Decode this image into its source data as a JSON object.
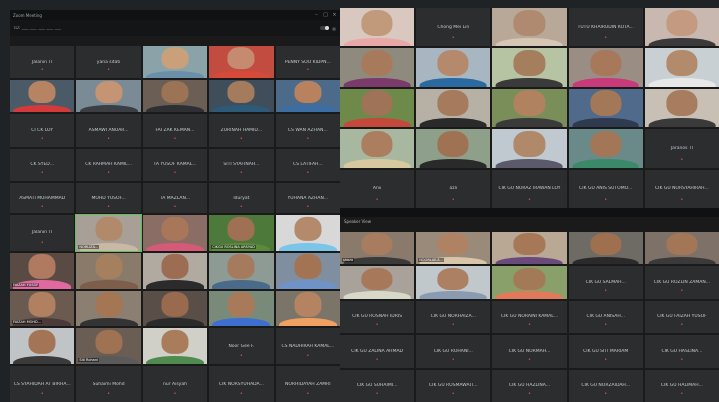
{
  "window_title": "Zoom Meeting",
  "menu_text": "ID: ___  ___  ___  ___  ___",
  "pin_text": "Speaker View",
  "tl": {
    "tiles": [
      {
        "name": "Jalanin TI",
        "kind": "name"
      },
      {
        "name": "yana sitati",
        "kind": "name"
      },
      {
        "name": "",
        "kind": "video",
        "skin": "#c9a07a",
        "shirt": "#6a8fa8",
        "bg": "#8aa3a8"
      },
      {
        "name": "",
        "kind": "video",
        "skin": "#c58a70",
        "shirt": "#d64a3a",
        "bg": "#c24c3f"
      },
      {
        "name": "PENNY SOO KIDPN...",
        "kind": "name"
      },
      {
        "name": "",
        "kind": "video",
        "skin": "#b78463",
        "shirt": "#d43a3a",
        "bg": "#4a5a66"
      },
      {
        "name": "",
        "kind": "video",
        "skin": "#c59472",
        "shirt": "#3b3f44",
        "bg": "#7b8b96"
      },
      {
        "name": "",
        "kind": "video",
        "skin": "#9d7355",
        "shirt": "#2d2f33",
        "bg": "#6b5e54"
      },
      {
        "name": "",
        "kind": "video",
        "skin": "#a57b5d",
        "shirt": "#2e5a7a",
        "bg": "#3f4e5a"
      },
      {
        "name": "",
        "kind": "video",
        "skin": "#b8825e",
        "shirt": "#3a6ea5",
        "bg": "#4c6b8a"
      },
      {
        "name": "CI CK LOY",
        "kind": "name"
      },
      {
        "name": "ASMAWI ANUAR...",
        "kind": "name"
      },
      {
        "name": "FAI ZAK KEMAN...",
        "kind": "name"
      },
      {
        "name": "ZURINAH HAMID...",
        "kind": "name"
      },
      {
        "name": "CS WAN AZHAN...",
        "kind": "name"
      },
      {
        "name": "CK SYED...",
        "kind": "name"
      },
      {
        "name": "CK RAHMAH KAMIL...",
        "kind": "name"
      },
      {
        "name": "TA YUSOF KAMAL...",
        "kind": "name"
      },
      {
        "name": "SITI SYAFINAH...",
        "kind": "name"
      },
      {
        "name": "CS LATIFAH...",
        "kind": "name"
      },
      {
        "name": "ASMATI MUHAMMAD",
        "kind": "name"
      },
      {
        "name": "MOHD YUSOF...",
        "kind": "name"
      },
      {
        "name": "TA MAZLAN...",
        "kind": "name"
      },
      {
        "name": "Iduryat",
        "kind": "name"
      },
      {
        "name": "YUHANA AZHAN...",
        "kind": "name"
      }
    ]
  },
  "bl": {
    "tiles": [
      {
        "name": "Jalanin TI",
        "kind": "name"
      },
      {
        "name": "NORLIZA...",
        "kind": "video",
        "skin": "#b08a6a",
        "shirt": "#c9b8a6",
        "bg": "#a8a096",
        "active": true
      },
      {
        "name": "",
        "kind": "video",
        "skin": "#a8775a",
        "shirt": "#d55a78",
        "bg": "#8a6d64"
      },
      {
        "name": "CIKGU ROSLINA ARSYAD",
        "kind": "video",
        "skin": "#a07055",
        "shirt": "#5b8a3d",
        "bg": "#4d7a3a"
      },
      {
        "name": "",
        "kind": "video",
        "skin": "#b48a6c",
        "shirt": "#7bc5e8",
        "bg": "#d8d8d8"
      },
      {
        "name": "FAIZAH YUSOF",
        "kind": "video",
        "skin": "#b07a60",
        "shirt": "#e06aa0",
        "bg": "#5a4a44"
      },
      {
        "name": "",
        "kind": "video",
        "skin": "#a5805e",
        "shirt": "#7d5e4a",
        "bg": "#8a7a6a"
      },
      {
        "name": "",
        "kind": "video",
        "skin": "#9c6d52",
        "shirt": "#2b2b2b",
        "bg": "#b0aaa0"
      },
      {
        "name": "",
        "kind": "video",
        "skin": "#a67b5d",
        "shirt": "#4a6a8a",
        "bg": "#8e9a94"
      },
      {
        "name": "",
        "kind": "video",
        "skin": "#a27454",
        "shirt": "#6f93c8",
        "bg": "#7f8fa0"
      },
      {
        "name": "FAIZAH MOHD...",
        "kind": "video",
        "skin": "#b08060",
        "shirt": "#4a3a3a",
        "bg": "#6b5a4f"
      },
      {
        "name": "",
        "kind": "video",
        "skin": "#a47654",
        "shirt": "#333333",
        "bg": "#8a7f70"
      },
      {
        "name": "",
        "kind": "video",
        "skin": "#9a6a4f",
        "shirt": "#2a2a2a",
        "bg": "#5a4f48"
      },
      {
        "name": "",
        "kind": "video",
        "skin": "#a87a5a",
        "shirt": "#3d6fd0",
        "bg": "#7a8a7a"
      },
      {
        "name": "",
        "kind": "video",
        "skin": "#b48462",
        "shirt": "#f0a060",
        "bg": "#7b7468"
      },
      {
        "name": "",
        "kind": "video",
        "skin": "#a37556",
        "shirt": "#3a3a3a",
        "bg": "#c0c4c6"
      },
      {
        "name": "Siti Rohani",
        "kind": "video",
        "skin": "#9e7252",
        "shirt": "#5a5a5a",
        "bg": "#6a5e54"
      },
      {
        "name": "",
        "kind": "video",
        "skin": "#a97c5c",
        "shirt": "#4f8a4f",
        "bg": "#d0d0c8"
      },
      {
        "name": "Noor Gee F.",
        "kind": "name"
      },
      {
        "name": "CS NADHIRAH KAMAL...",
        "kind": "name"
      },
      {
        "name": "CS SYAHIDAH AT BIRHA...",
        "kind": "name"
      },
      {
        "name": "Suhaimi Mohd",
        "kind": "name"
      },
      {
        "name": "nur Aisyah",
        "kind": "name"
      },
      {
        "name": "CIK NORSYUHADA...",
        "kind": "name"
      },
      {
        "name": "NORHIDAYAH ZAMRI",
        "kind": "name"
      }
    ]
  },
  "tr": {
    "tiles": [
      {
        "name": "",
        "kind": "video",
        "skin": "#c09a7a",
        "shirt": "#e8a8a8",
        "bg": "#d8c8c0"
      },
      {
        "name": "Chong Mei Lin",
        "kind": "name"
      },
      {
        "name": "",
        "kind": "video",
        "skin": "#b08a70",
        "shirt": "#d6c6b4",
        "bg": "#b8a898"
      },
      {
        "name": "TUTU KHAIRUDIN KOTA...",
        "kind": "name"
      },
      {
        "name": "",
        "kind": "video",
        "skin": "#c49a80",
        "shirt": "#3a3a3a",
        "bg": "#c8b8b0"
      },
      {
        "name": "",
        "kind": "video",
        "skin": "#a87a5c",
        "shirt": "#7a3a6a",
        "bg": "#8f8a7e"
      },
      {
        "name": "",
        "kind": "video",
        "skin": "#b58a6c",
        "shirt": "#2a6aa0",
        "bg": "#a7b6c0"
      },
      {
        "name": "",
        "kind": "video",
        "skin": "#a57e5e",
        "shirt": "#3a3a3a",
        "bg": "#b7c4a4"
      },
      {
        "name": "",
        "kind": "video",
        "skin": "#a8785a",
        "shirt": "#c83a7a",
        "bg": "#9a8e84"
      },
      {
        "name": "",
        "kind": "video",
        "skin": "#b28a6c",
        "shirt": "#e8e8e8",
        "bg": "#c8d0d4"
      },
      {
        "name": "",
        "kind": "video",
        "skin": "#9f7357",
        "shirt": "#c4493a",
        "bg": "#6e8a4a"
      },
      {
        "name": "",
        "kind": "video",
        "skin": "#a67a5c",
        "shirt": "#2a2a2a",
        "bg": "#b7b0a4"
      },
      {
        "name": "",
        "kind": "video",
        "skin": "#b08260",
        "shirt": "#3a3a3a",
        "bg": "#7a8e5a"
      },
      {
        "name": "",
        "kind": "video",
        "skin": "#a37858",
        "shirt": "#2f3a4f",
        "bg": "#4f6a8a"
      },
      {
        "name": "",
        "kind": "video",
        "skin": "#a87c5e",
        "shirt": "#3a3a3a",
        "bg": "#c8c0b4"
      },
      {
        "name": "",
        "kind": "video",
        "skin": "#aa7e5e",
        "shirt": "#d8c8a0",
        "bg": "#a8b8a0"
      },
      {
        "name": "",
        "kind": "video",
        "skin": "#9e7252",
        "shirt": "#2a2a2a",
        "bg": "#8fa08a"
      },
      {
        "name": "",
        "kind": "video",
        "skin": "#b0886a",
        "shirt": "#5a5a6a",
        "bg": "#c0c8d0"
      },
      {
        "name": "",
        "kind": "video",
        "skin": "#a27656",
        "shirt": "#3a8a6a",
        "bg": "#6a8a8a"
      },
      {
        "name": "Jaranos TI",
        "kind": "name"
      },
      {
        "name": "Anii",
        "kind": "name"
      },
      {
        "name": "azli",
        "kind": "name"
      },
      {
        "name": "CIK GU NORAZ IRAWAN LOY",
        "kind": "name"
      },
      {
        "name": "CIK GU ANIS SUTOMO...",
        "kind": "name"
      },
      {
        "name": "CIK GU NORSYAHIRAH...",
        "kind": "name"
      }
    ]
  },
  "br": {
    "tiles": [
      {
        "name": "shaza",
        "kind": "video",
        "skin": "#a87c5e",
        "shirt": "#3a3a3a",
        "bg": "#8a7a6c"
      },
      {
        "name": "NOORLAILA...",
        "kind": "video",
        "skin": "#b08264",
        "shirt": "#d8c4a8",
        "bg": "#9a8a7a"
      },
      {
        "name": "",
        "kind": "video",
        "skin": "#a67858",
        "shirt": "#6a4a7a",
        "bg": "#b8a894"
      },
      {
        "name": "",
        "kind": "video",
        "skin": "#9e7050",
        "shirt": "#2a2a2a",
        "bg": "#6e6a64"
      },
      {
        "name": "",
        "kind": "video",
        "skin": "#a27656",
        "shirt": "#3a3a3a",
        "bg": "#7e7268"
      },
      {
        "name": "",
        "kind": "video",
        "skin": "#a8785a",
        "shirt": "#d8d8c8",
        "bg": "#a8a29a"
      },
      {
        "name": "",
        "kind": "video",
        "skin": "#ac8062",
        "shirt": "#8a9ab0",
        "bg": "#c0c8cc"
      },
      {
        "name": "",
        "kind": "video",
        "skin": "#a27a58",
        "shirt": "#e07a5a",
        "bg": "#8aa06a"
      },
      {
        "name": "CIK GU SALMAH...",
        "kind": "name"
      },
      {
        "name": "CIK GU ROZLIN ZAMAN...",
        "kind": "name"
      },
      {
        "name": "CIK GU ROSNAH IDRIS",
        "kind": "name"
      },
      {
        "name": "CIK GU NORHAIZA...",
        "kind": "name"
      },
      {
        "name": "CIK GU NORAINI KAMAL...",
        "kind": "name"
      },
      {
        "name": "CIK GU ANISAH...",
        "kind": "name"
      },
      {
        "name": "CIK GU FAIZAH YUSOF",
        "kind": "name"
      },
      {
        "name": "CIK GU ZALINA AHMAD",
        "kind": "name"
      },
      {
        "name": "CIK GU ROHANI...",
        "kind": "name"
      },
      {
        "name": "CIK GU NORMAH...",
        "kind": "name"
      },
      {
        "name": "CIK GU SITI MARIAM",
        "kind": "name"
      },
      {
        "name": "CIK GU HASLINA...",
        "kind": "name"
      },
      {
        "name": "CIK GU SUHAIMI...",
        "kind": "name"
      },
      {
        "name": "CIK GU ROSMAWATI...",
        "kind": "name"
      },
      {
        "name": "CIK GU HAZLINA...",
        "kind": "name"
      },
      {
        "name": "CIK GU NORZAIDAH...",
        "kind": "name"
      },
      {
        "name": "CIK GU HALIMAH...",
        "kind": "name"
      }
    ]
  }
}
